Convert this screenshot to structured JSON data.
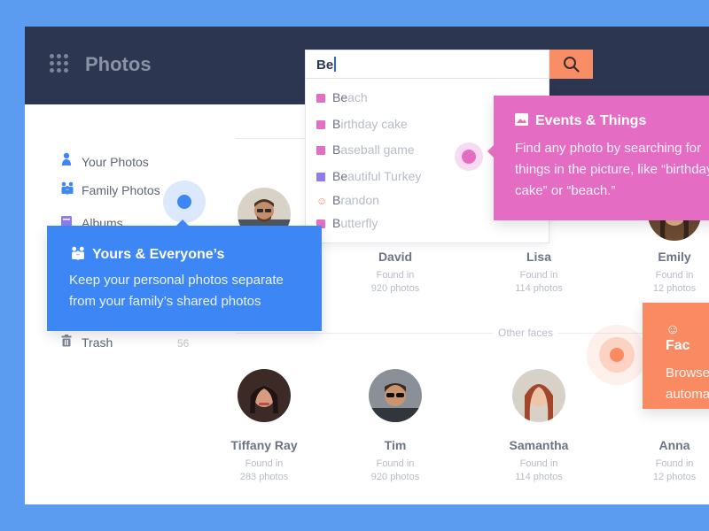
{
  "app": {
    "title": "Photos"
  },
  "search": {
    "value": "Be"
  },
  "suggestions": [
    {
      "match": "Be",
      "rest": "ach",
      "icon": "image-icon"
    },
    {
      "match": "B",
      "rest": "irthday cake",
      "icon": "image-icon"
    },
    {
      "match": "B",
      "rest": "aseball game",
      "icon": "image-icon"
    },
    {
      "match": "Be",
      "rest": "autiful Turkey",
      "icon": "album-icon"
    },
    {
      "match": "B",
      "rest": "randon",
      "icon": "face-icon"
    },
    {
      "match": "B",
      "rest": "utterfly",
      "icon": "image-icon"
    }
  ],
  "sidebar": {
    "items": [
      {
        "label": "Your Photos",
        "icon": "person-icon"
      },
      {
        "label": "Family Photos",
        "icon": "family-icon"
      },
      {
        "label": "Albums",
        "icon": "album-icon"
      },
      {
        "label": "Trash",
        "icon": "trash-icon",
        "count": "56"
      }
    ]
  },
  "faces": {
    "top": [
      {
        "name": "David",
        "found": "Found in",
        "count": "920 photos"
      },
      {
        "name": "Lisa",
        "found": "Found in",
        "count": "114 photos"
      },
      {
        "name": "Emily",
        "found": "Found in",
        "count": "12 photos"
      }
    ],
    "other_label": "Other faces",
    "other": [
      {
        "name": "Tiffany Ray",
        "found": "Found in",
        "count": "283 photos"
      },
      {
        "name": "Tim",
        "found": "Found in",
        "count": "920 photos"
      },
      {
        "name": "Samantha",
        "found": "Found in",
        "count": "114 photos"
      },
      {
        "name": "Anna",
        "found": "Found in",
        "count": "12 photos"
      }
    ]
  },
  "tooltips": {
    "yours": {
      "title": "Yours & Everyone’s",
      "body": "Keep your personal photos separate from your family’s shared photos"
    },
    "events": {
      "title": "Events & Things",
      "body": "Find any photo by searching for things in the picture, like “birthday cake” or “beach.”"
    },
    "faces": {
      "title": "Fac",
      "body": "Browse automa"
    }
  },
  "colors": {
    "background": "#5b9cf0",
    "topbar": "#2d3650",
    "accent_blue": "#3d86f5",
    "accent_pink": "#e56cc3",
    "accent_orange": "#f98a61"
  }
}
